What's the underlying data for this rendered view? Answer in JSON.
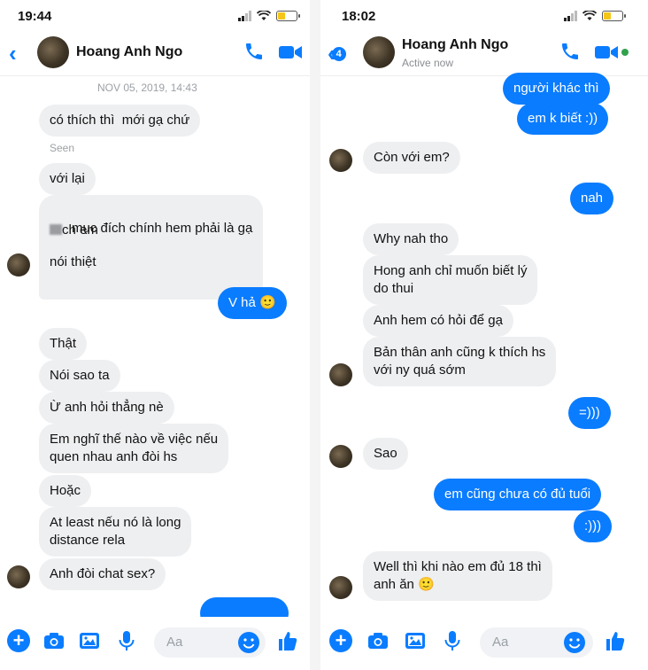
{
  "left": {
    "status_time": "19:44",
    "contact_name": "Hoang Anh Ngo",
    "timestamp": "NOV 05, 2019, 14:43",
    "seen_label": "Seen",
    "messages": [
      {
        "text": "có thích thì  mới gạ chứ"
      },
      {
        "text": "với lại"
      },
      {
        "text": "mục đích chính hem phải là gạ"
      },
      {
        "text": "ch em"
      },
      {
        "text": "nói thiệt"
      },
      {
        "text": "V hả 🙂"
      },
      {
        "text": "Thật"
      },
      {
        "text": "Nói sao ta"
      },
      {
        "text": "Ừ anh hỏi thẳng nè"
      },
      {
        "text": "Em nghĩ thế nào về việc nếu\nquen nhau anh đòi hs"
      },
      {
        "text": "Hoặc"
      },
      {
        "text": "At least nếu nó là long\ndistance rela"
      },
      {
        "text": "Anh đòi chat sex?"
      }
    ],
    "composer_placeholder": "Aa"
  },
  "right": {
    "status_time": "18:02",
    "back_badge": "4",
    "contact_name": "Hoang Anh Ngo",
    "active_status": "Active now",
    "messages": [
      {
        "text": "người khác thì"
      },
      {
        "text": "em k biết :))"
      },
      {
        "text": "Còn với em?"
      },
      {
        "text": "nah"
      },
      {
        "text": "Why nah tho"
      },
      {
        "text": "Hong anh chỉ muốn biết lý\ndo thui"
      },
      {
        "text": "Anh hem có hỏi để gạ"
      },
      {
        "text": "Bản thân anh cũng k thích hs\nvới ny quá sớm"
      },
      {
        "text": "=)))"
      },
      {
        "text": "Sao"
      },
      {
        "text": "em cũng chưa có đủ tuổi"
      },
      {
        "text": ":)))"
      },
      {
        "text": "Well thì khi nào em đủ 18 thì\nanh ăn 🙂"
      }
    ],
    "composer_placeholder": "Aa"
  },
  "colors": {
    "accent": "#0a7cff",
    "incoming_bubble": "#eeeff1",
    "online": "#31a24c"
  },
  "icons": [
    "back-chevron-icon",
    "phone-icon",
    "video-camera-icon",
    "plus-icon",
    "camera-icon",
    "gallery-icon",
    "microphone-icon",
    "emoji-icon",
    "thumbs-up-icon"
  ]
}
